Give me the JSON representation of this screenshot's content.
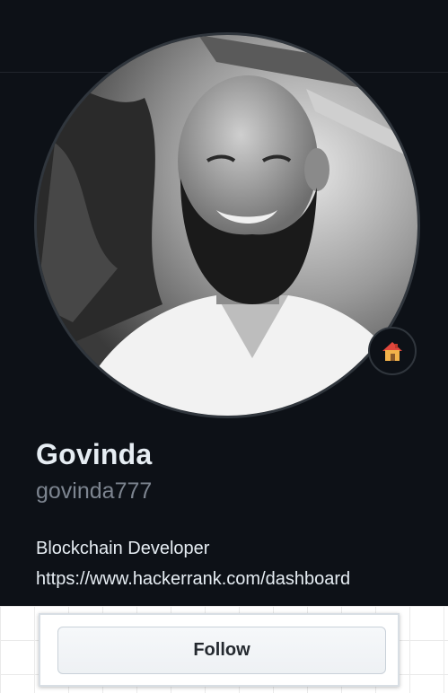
{
  "profile": {
    "name": "Govinda",
    "username": "govinda777",
    "bio_line1": "Blockchain Developer",
    "bio_line2": "https://www.hackerrank.com/dashboard",
    "status_icon": "house-icon"
  },
  "actions": {
    "follow_label": "Follow"
  },
  "colors": {
    "background": "#0d1117",
    "name_text": "#e6edf3",
    "username_text": "#7d8590",
    "button_bg": "#f6f8fa"
  }
}
